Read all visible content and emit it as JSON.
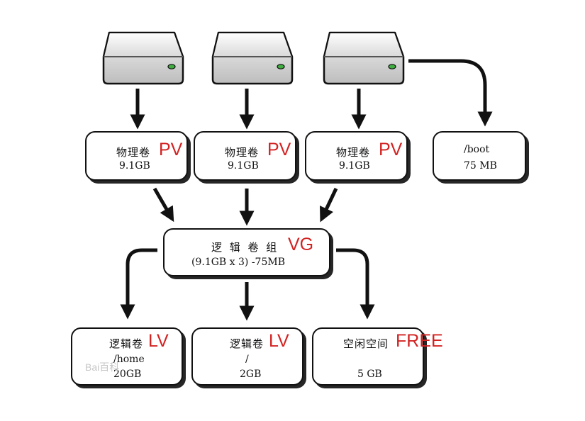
{
  "pv": [
    {
      "label": "物理卷",
      "tag": "PV",
      "size": "9.1GB"
    },
    {
      "label": "物理卷",
      "tag": "PV",
      "size": "9.1GB"
    },
    {
      "label": "物理卷",
      "tag": "PV",
      "size": "9.1GB"
    }
  ],
  "boot": {
    "path": "/boot",
    "size": "75 MB"
  },
  "vg": {
    "label": "逻 辑 卷 组",
    "tag": "VG",
    "size": "(9.1GB x 3) -75MB"
  },
  "lv": [
    {
      "label": "逻辑卷",
      "tag": "LV",
      "mount": "/home",
      "size": "20GB"
    },
    {
      "label": "逻辑卷",
      "tag": "LV",
      "mount": "/",
      "size": "2GB"
    }
  ],
  "free": {
    "label": "空闲空间",
    "tag": "FREE",
    "size": "5 GB"
  },
  "watermark": "Bai百科",
  "colors": {
    "accent": "#d32222",
    "stroke": "#111111",
    "led": "#3fae3f"
  }
}
